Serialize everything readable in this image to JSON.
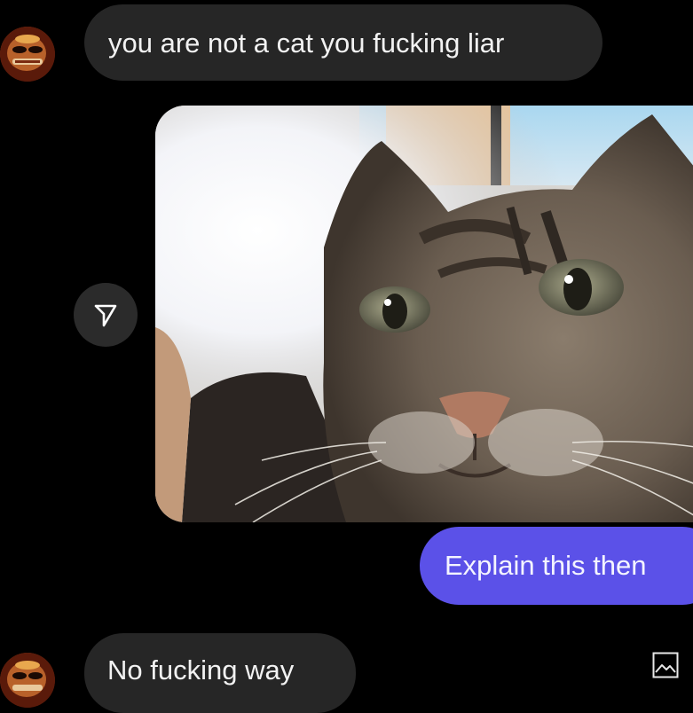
{
  "messages": [
    {
      "sender": "other",
      "text": "you are not a cat you fucking liar"
    },
    {
      "sender": "me",
      "text": "Explain this then"
    },
    {
      "sender": "other",
      "text": "No fucking way"
    }
  ],
  "icons": {
    "avatar": "avatar-icon",
    "share": "send-triangle-icon",
    "photo_placeholder": "image-icon"
  },
  "colors": {
    "background": "#000000",
    "incoming_bubble": "#262626",
    "outgoing_bubble": "#5b51e8"
  }
}
